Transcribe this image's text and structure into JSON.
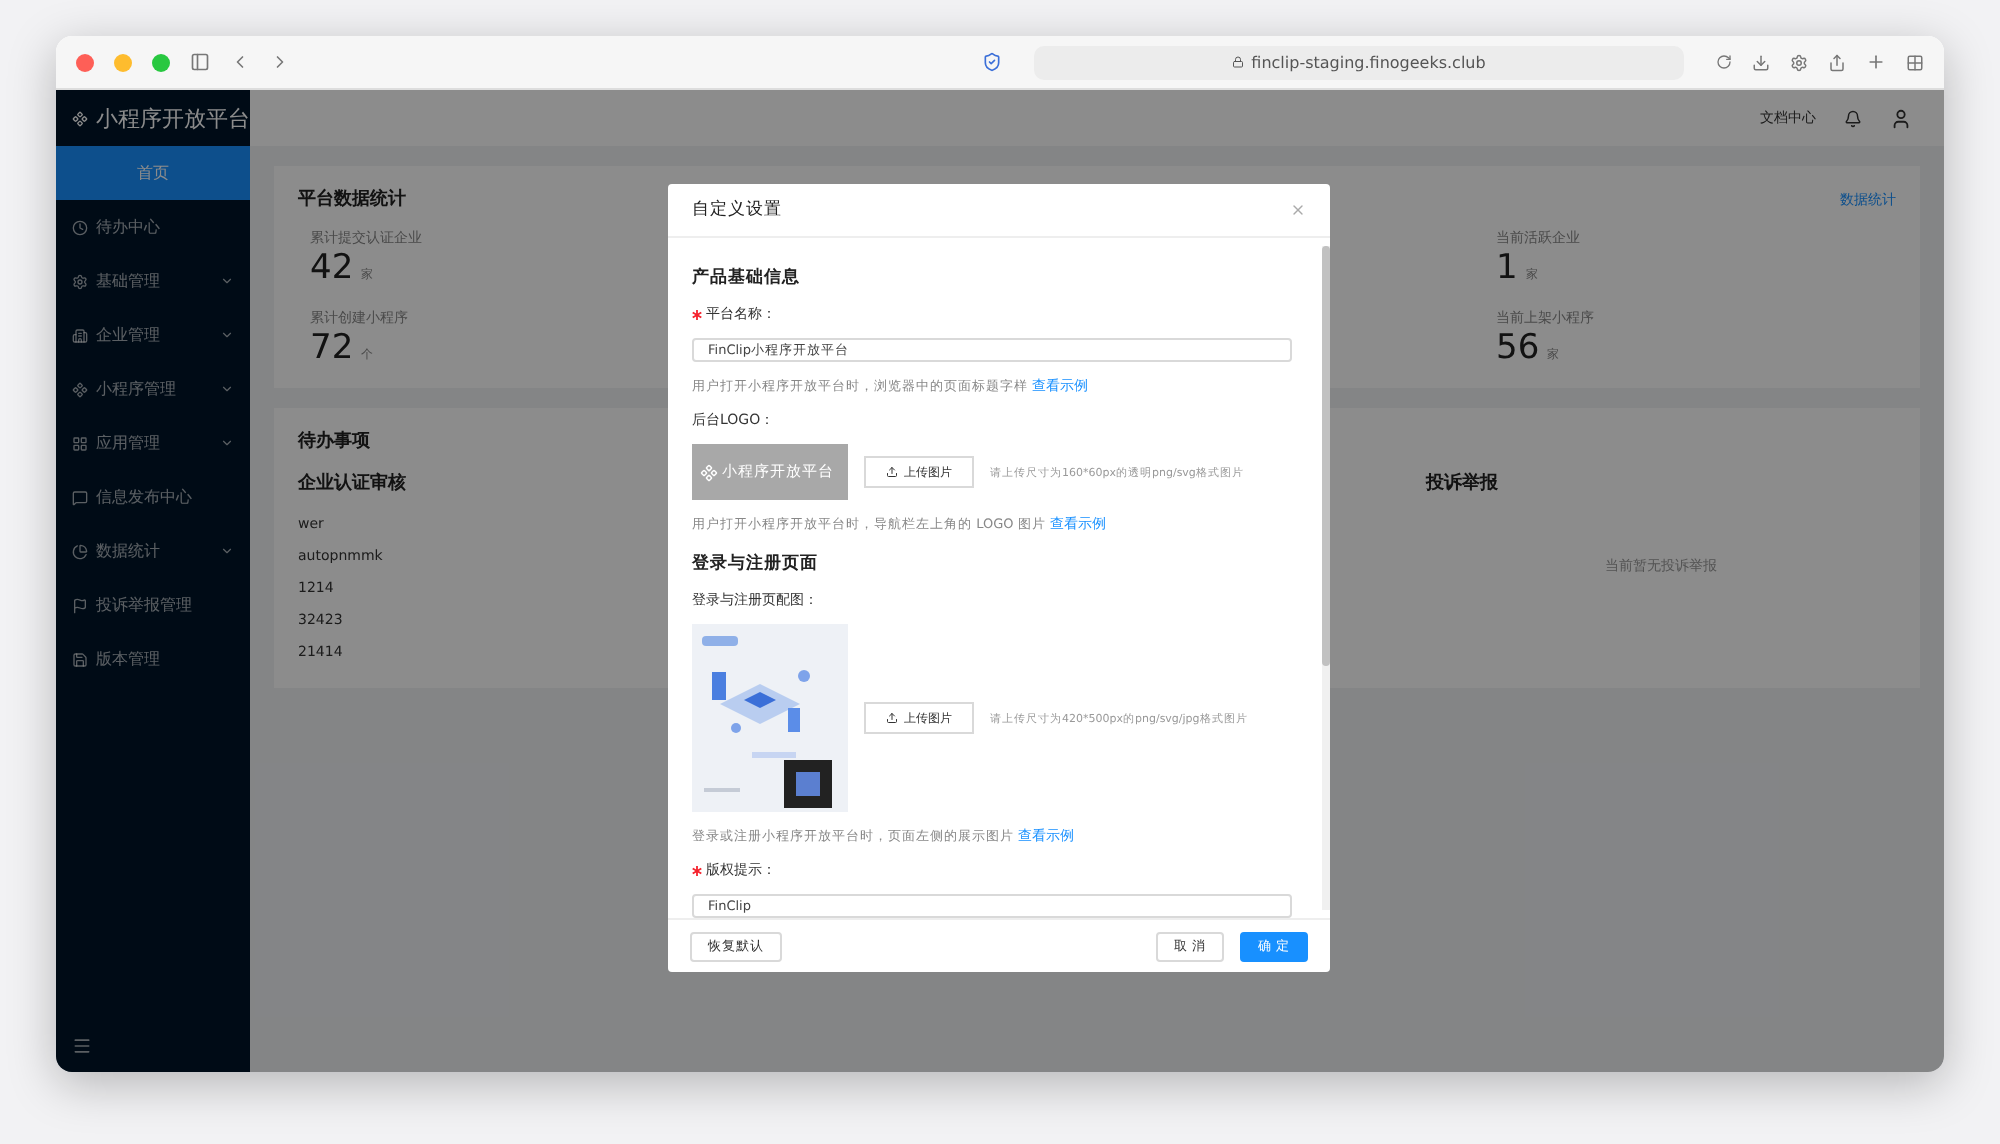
{
  "browser": {
    "url": "finclip-staging.finogeeks.club"
  },
  "sidebar": {
    "logo": "小程序开放平台",
    "items": [
      {
        "label": "首页",
        "selected": true,
        "expandable": false
      },
      {
        "label": "待办中心",
        "selected": false,
        "expandable": false
      },
      {
        "label": "基础管理",
        "selected": false,
        "expandable": true
      },
      {
        "label": "企业管理",
        "selected": false,
        "expandable": true
      },
      {
        "label": "小程序管理",
        "selected": false,
        "expandable": true
      },
      {
        "label": "应用管理",
        "selected": false,
        "expandable": true
      },
      {
        "label": "信息发布中心",
        "selected": false,
        "expandable": false
      },
      {
        "label": "数据统计",
        "selected": false,
        "expandable": true
      },
      {
        "label": "投诉举报管理",
        "selected": false,
        "expandable": false
      },
      {
        "label": "版本管理",
        "selected": false,
        "expandable": false
      }
    ]
  },
  "header": {
    "docs_link": "文档中心"
  },
  "stats": {
    "title": "平台数据统计",
    "link": "数据统计",
    "items": [
      {
        "label": "累计提交认证企业",
        "value": "42",
        "unit": "家"
      },
      {
        "label": "当前活跃企业",
        "value": "1",
        "unit": "家"
      },
      {
        "label": "累计创建小程序",
        "value": "72",
        "unit": "个"
      },
      {
        "label": "当前上架小程序",
        "value": "56",
        "unit": "家"
      }
    ]
  },
  "todo": {
    "title": "待办事项",
    "review": {
      "title": "企业认证审核",
      "rows": [
        "wer",
        "autopnmmk",
        "1214",
        "32423",
        "21414"
      ]
    },
    "complaints": {
      "title": "投诉举报",
      "empty": "当前暂无投诉举报"
    }
  },
  "dialog": {
    "title": "自定义设置",
    "sections": [
      {
        "title": "产品基础信息",
        "fields": [
          {
            "kind": "input",
            "label": "平台名称：",
            "required": true,
            "value": "FinClip小程序开放平台",
            "hint": "用户打开小程序开放平台时，浏览器中的页面标题字样",
            "link": "查看示例"
          },
          {
            "kind": "logo",
            "label": "后台LOGO：",
            "required": false,
            "preview": "小程序开放平台",
            "button": "上传图片",
            "requirement": "请上传尺寸为160*60px的透明png/svg格式图片",
            "hint": "用户打开小程序开放平台时，导航栏左上角的 LOGO 图片",
            "link": "查看示例"
          }
        ]
      },
      {
        "title": "登录与注册页面",
        "fields": [
          {
            "label": "登录与注册页配图：",
            "required": false,
            "button": "上传图片",
            "requirement": "请上传尺寸为420*500px的png/svg/jpg格式图片",
            "hint": "登录或注册小程序开放平台时，页面左侧的展示图片",
            "link": "查看示例"
          },
          {
            "kind": "input",
            "label": "版权提示：",
            "required": true,
            "value": "FinClip"
          }
        ]
      }
    ],
    "reset": "恢复默认",
    "cancel": "取 消",
    "ok": "确 定"
  }
}
